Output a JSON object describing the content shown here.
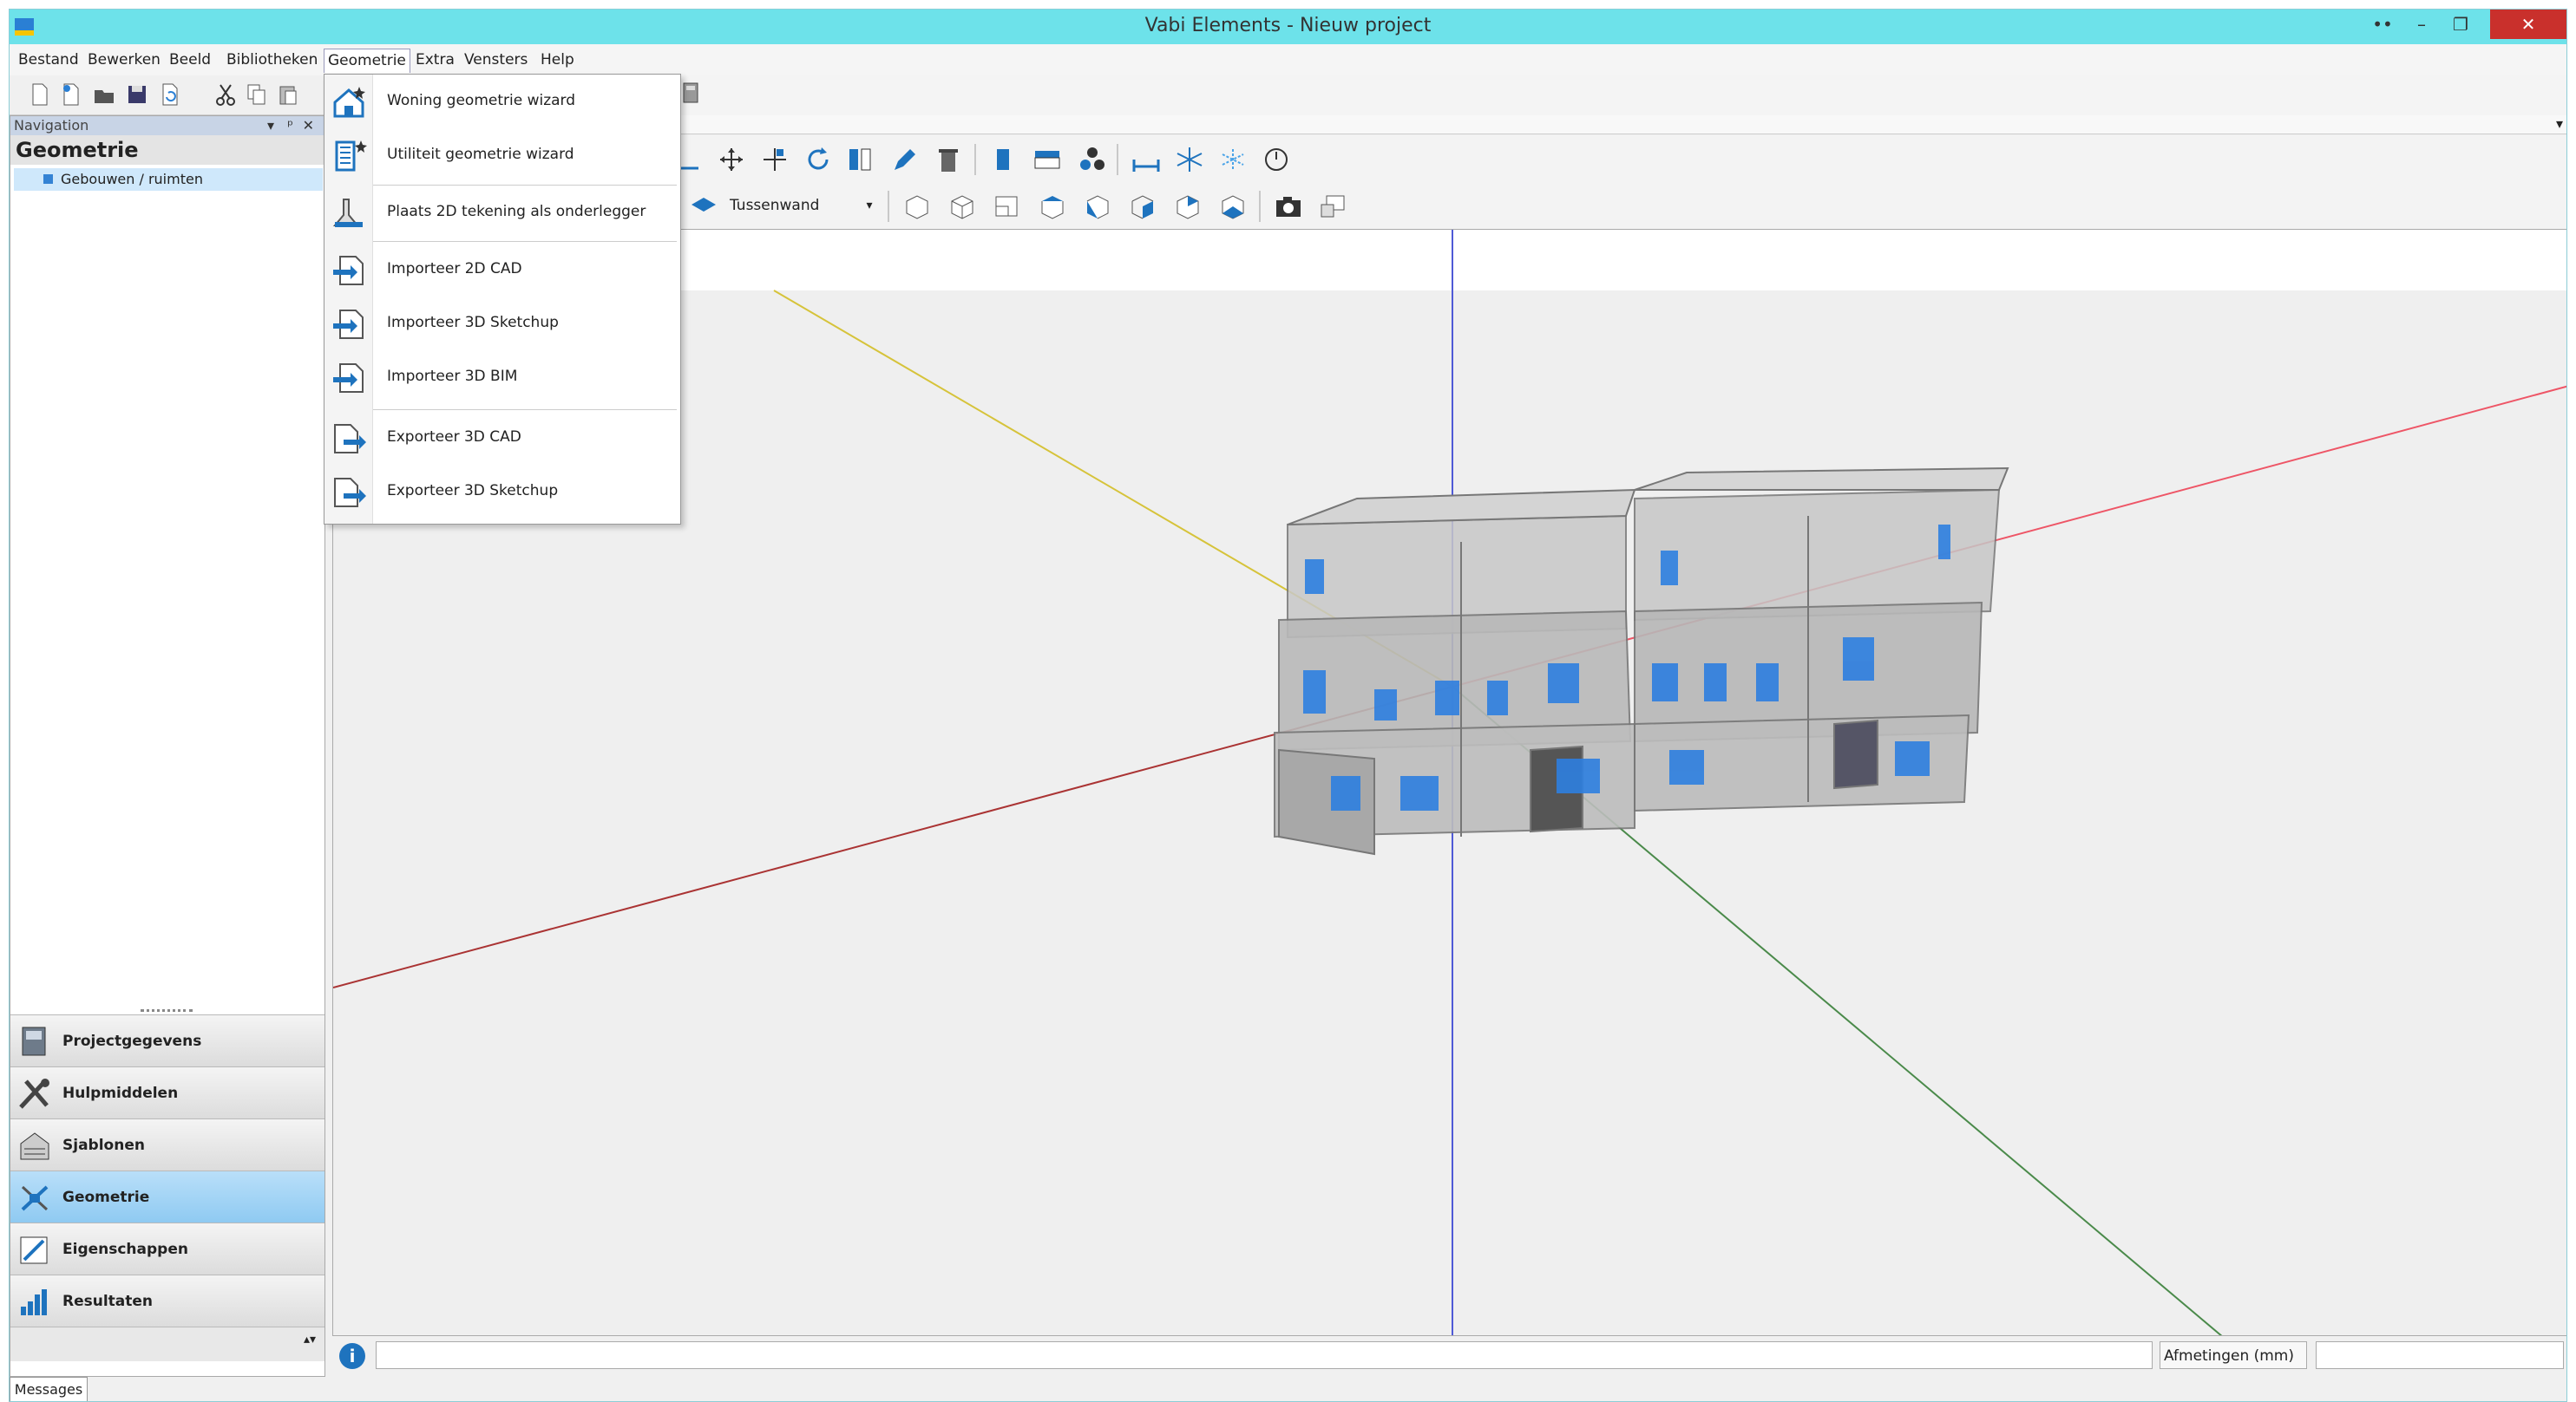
{
  "window": {
    "title": "Vabi Elements - Nieuw project",
    "restore_glyph": "••",
    "min_glyph": "–",
    "max_glyph": "❐",
    "close_glyph": "✕"
  },
  "menubar": {
    "items": [
      "Bestand",
      "Bewerken",
      "Beeld",
      "Bibliotheken",
      "Geometrie",
      "Extra",
      "Vensters",
      "Help"
    ],
    "open_item": "Geometrie"
  },
  "navigation": {
    "header": "Navigation",
    "section_title": "Geometrie",
    "tree_item": "Gebouwen / ruimten",
    "ctl_dropdown": "▾",
    "ctl_pin": "ᵖ",
    "ctl_close": "✕"
  },
  "nav_buttons": [
    {
      "label": "Projectgegevens",
      "icon": "project-icon"
    },
    {
      "label": "Hulpmiddelen",
      "icon": "tools-icon"
    },
    {
      "label": "Sjablonen",
      "icon": "templates-icon"
    },
    {
      "label": "Geometrie",
      "icon": "geometry-icon",
      "active": true
    },
    {
      "label": "Eigenschappen",
      "icon": "properties-icon"
    },
    {
      "label": "Resultaten",
      "icon": "results-icon"
    }
  ],
  "geometrie_menu": [
    {
      "label": "Woning geometrie wizard",
      "icon": "house-wizard-icon"
    },
    {
      "label": "Utiliteit geometrie wizard",
      "icon": "utility-wizard-icon"
    },
    {
      "label": "Plaats 2D tekening als onderlegger",
      "icon": "place-drawing-icon"
    },
    {
      "label": "Importeer 2D CAD",
      "icon": "import-2d-cad-icon"
    },
    {
      "label": "Importeer 3D Sketchup",
      "icon": "import-3d-sketchup-icon"
    },
    {
      "label": "Importeer 3D BIM",
      "icon": "import-3d-bim-icon"
    },
    {
      "label": "Exporteer 3D CAD",
      "icon": "export-3d-cad-icon"
    },
    {
      "label": "Exporteer 3D Sketchup",
      "icon": "export-3d-sketchup-icon"
    }
  ],
  "toolbar": {
    "wall_type": "Tussenwand",
    "dropdown_glyph": "▾"
  },
  "status": {
    "info_glyph": "i",
    "dimensions_label": "Afmetingen (mm)",
    "dimensions_value": ""
  },
  "bottom_tab": "Messages",
  "colors": {
    "titlebar": "#6de2ea",
    "accent": "#1e73be",
    "active_nav": "#9fd3f6",
    "close_button": "#c9302c"
  }
}
